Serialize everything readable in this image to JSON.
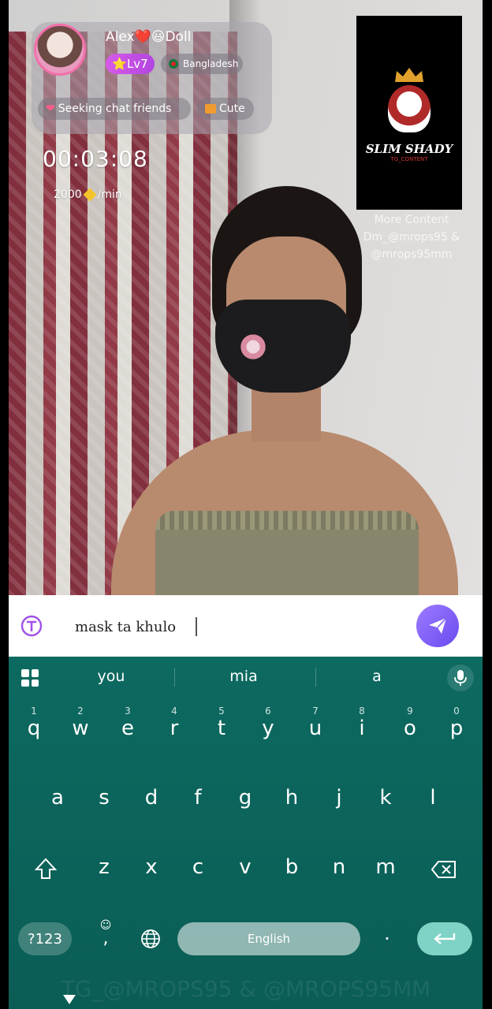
{
  "profile": {
    "username": "Alex❤️😃Doll",
    "level": "⭐Lv7",
    "country": "Bangladesh",
    "tags": [
      "Seeking chat friends",
      "Cute"
    ],
    "timer": "00:03:08",
    "rate": "2000",
    "rate_unit": "/min"
  },
  "watermark": {
    "logo_title": "SLIM SHADY",
    "logo_sub": "TG_CONTENT",
    "line1": "More Content",
    "line2": "Dm_@mrops95 &",
    "line3": "@mrops95mm",
    "bottom": "TG_@MROPS95 & @MROPS95MM"
  },
  "chat_input": {
    "value": "mask ta khulo"
  },
  "keyboard": {
    "suggestions": [
      "you",
      "mia",
      "a"
    ],
    "row1": [
      {
        "key": "q",
        "hint": "1"
      },
      {
        "key": "w",
        "hint": "2"
      },
      {
        "key": "e",
        "hint": "3"
      },
      {
        "key": "r",
        "hint": "4"
      },
      {
        "key": "t",
        "hint": "5"
      },
      {
        "key": "y",
        "hint": "6"
      },
      {
        "key": "u",
        "hint": "7"
      },
      {
        "key": "i",
        "hint": "8"
      },
      {
        "key": "o",
        "hint": "9"
      },
      {
        "key": "p",
        "hint": "0"
      }
    ],
    "row2": [
      "a",
      "s",
      "d",
      "f",
      "g",
      "h",
      "j",
      "k",
      "l"
    ],
    "row3": [
      "z",
      "x",
      "c",
      "v",
      "b",
      "n",
      "m"
    ],
    "symbols_label": "?123",
    "emoji_label": "☺",
    "comma_label": ",",
    "space_label": "English",
    "period_label": "."
  },
  "colors": {
    "keyboard_bg": "#0d6a61",
    "send_button": "#7b5cf5",
    "level_badge": "#c94fe3"
  }
}
